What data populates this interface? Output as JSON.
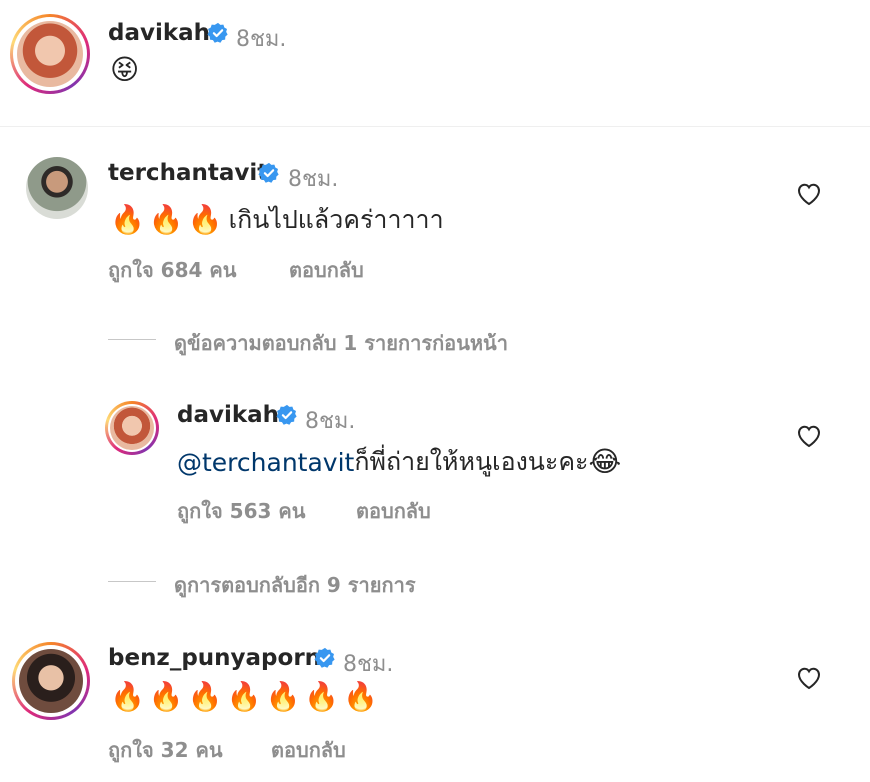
{
  "post": {
    "username": "davikah",
    "time": "8ชม.",
    "emoji": "😝"
  },
  "comments": [
    {
      "username": "terchantavit",
      "time": "8ชม.",
      "emoji": "🔥🔥🔥",
      "text": "เกินไปแล้วคร่าาาาา",
      "likes": "ถูกใจ 684 คน",
      "reply_label": "ตอบกลับ"
    },
    {
      "username": "davikah",
      "time": "8ชม.",
      "mention": "@terchantavit",
      "text": " ก็พี่ถ่ายให้หนูเองนะคะ",
      "emoji": "😂",
      "likes": "ถูกใจ 563 คน",
      "reply_label": "ตอบกลับ"
    },
    {
      "username": "benz_punyaporn",
      "time": "8ชม.",
      "emoji": "🔥🔥🔥🔥🔥🔥🔥",
      "likes": "ถูกใจ 32 คน",
      "reply_label": "ตอบกลับ"
    }
  ],
  "view_previous_replies": "ดูข้อความตอบกลับ 1 รายการก่อนหน้า",
  "view_more_replies": "ดูการตอบกลับอีก 9 รายการ",
  "icons": {
    "verified": "verified-badge-icon",
    "like": "heart-icon"
  },
  "colors": {
    "verified": "#3897f0",
    "mention": "#00376b",
    "secondary": "#8e8e8e"
  }
}
